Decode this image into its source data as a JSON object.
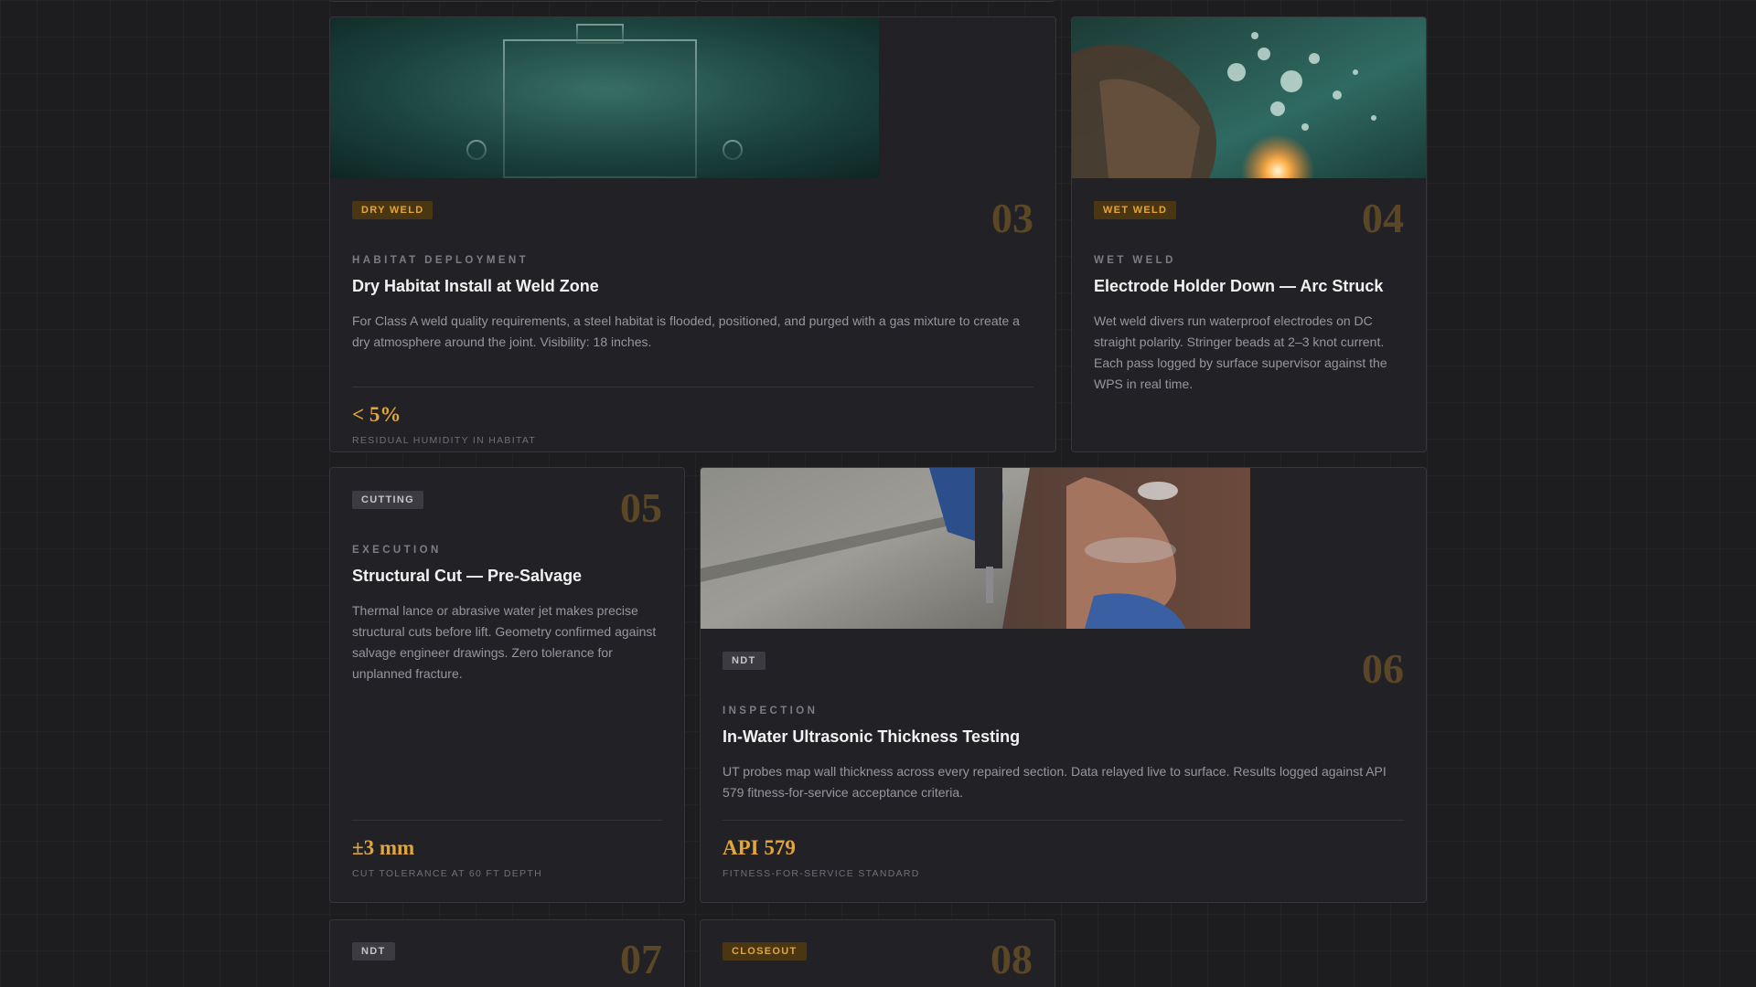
{
  "cards": {
    "c03": {
      "tag": "DRY WELD",
      "tag_color": "#e3a53a",
      "number": "03",
      "eyebrow": "HABITAT DEPLOYMENT",
      "title": "Dry Habitat Install at Weld Zone",
      "description": "For Class A weld quality requirements, a steel habitat is flooded, positioned, and purged with a gas mixture to create a dry atmosphere around the joint. Visibility: 18 inches.",
      "stat_value": "< 5%",
      "stat_label": "RESIDUAL HUMIDITY IN HABITAT"
    },
    "c04": {
      "tag": "WET WELD",
      "number": "04",
      "eyebrow": "WET WELD",
      "title": "Electrode Holder Down — Arc Struck",
      "description": "Wet weld divers run waterproof electrodes on DC straight polarity. Stringer beads at 2–3 knot current. Each pass logged by surface supervisor against the WPS in real time."
    },
    "c05": {
      "tag": "CUTTING",
      "number": "05",
      "eyebrow": "EXECUTION",
      "title": "Structural Cut — Pre-Salvage",
      "description": "Thermal lance or abrasive water jet makes precise structural cuts before lift. Geometry confirmed against salvage engineer drawings. Zero tolerance for unplanned fracture.",
      "stat_value": "±3 mm",
      "stat_label": "CUT TOLERANCE AT 60 FT DEPTH"
    },
    "c06": {
      "tag": "NDT",
      "number": "06",
      "eyebrow": "INSPECTION",
      "title": "In-Water Ultrasonic Thickness Testing",
      "description": "UT probes map wall thickness across every repaired section. Data relayed live to surface. Results logged against API 579 fitness-for-service acceptance criteria.",
      "stat_value": "API 579",
      "stat_label": "FITNESS-FOR-SERVICE STANDARD"
    },
    "c07": {
      "tag": "NDT",
      "number": "07"
    },
    "c08": {
      "tag": "CLOSEOUT",
      "number": "08"
    }
  },
  "colors": {
    "accent": "#e3a53a",
    "number": "#5b4726",
    "background": "#1d1d20",
    "card": "#222226"
  }
}
